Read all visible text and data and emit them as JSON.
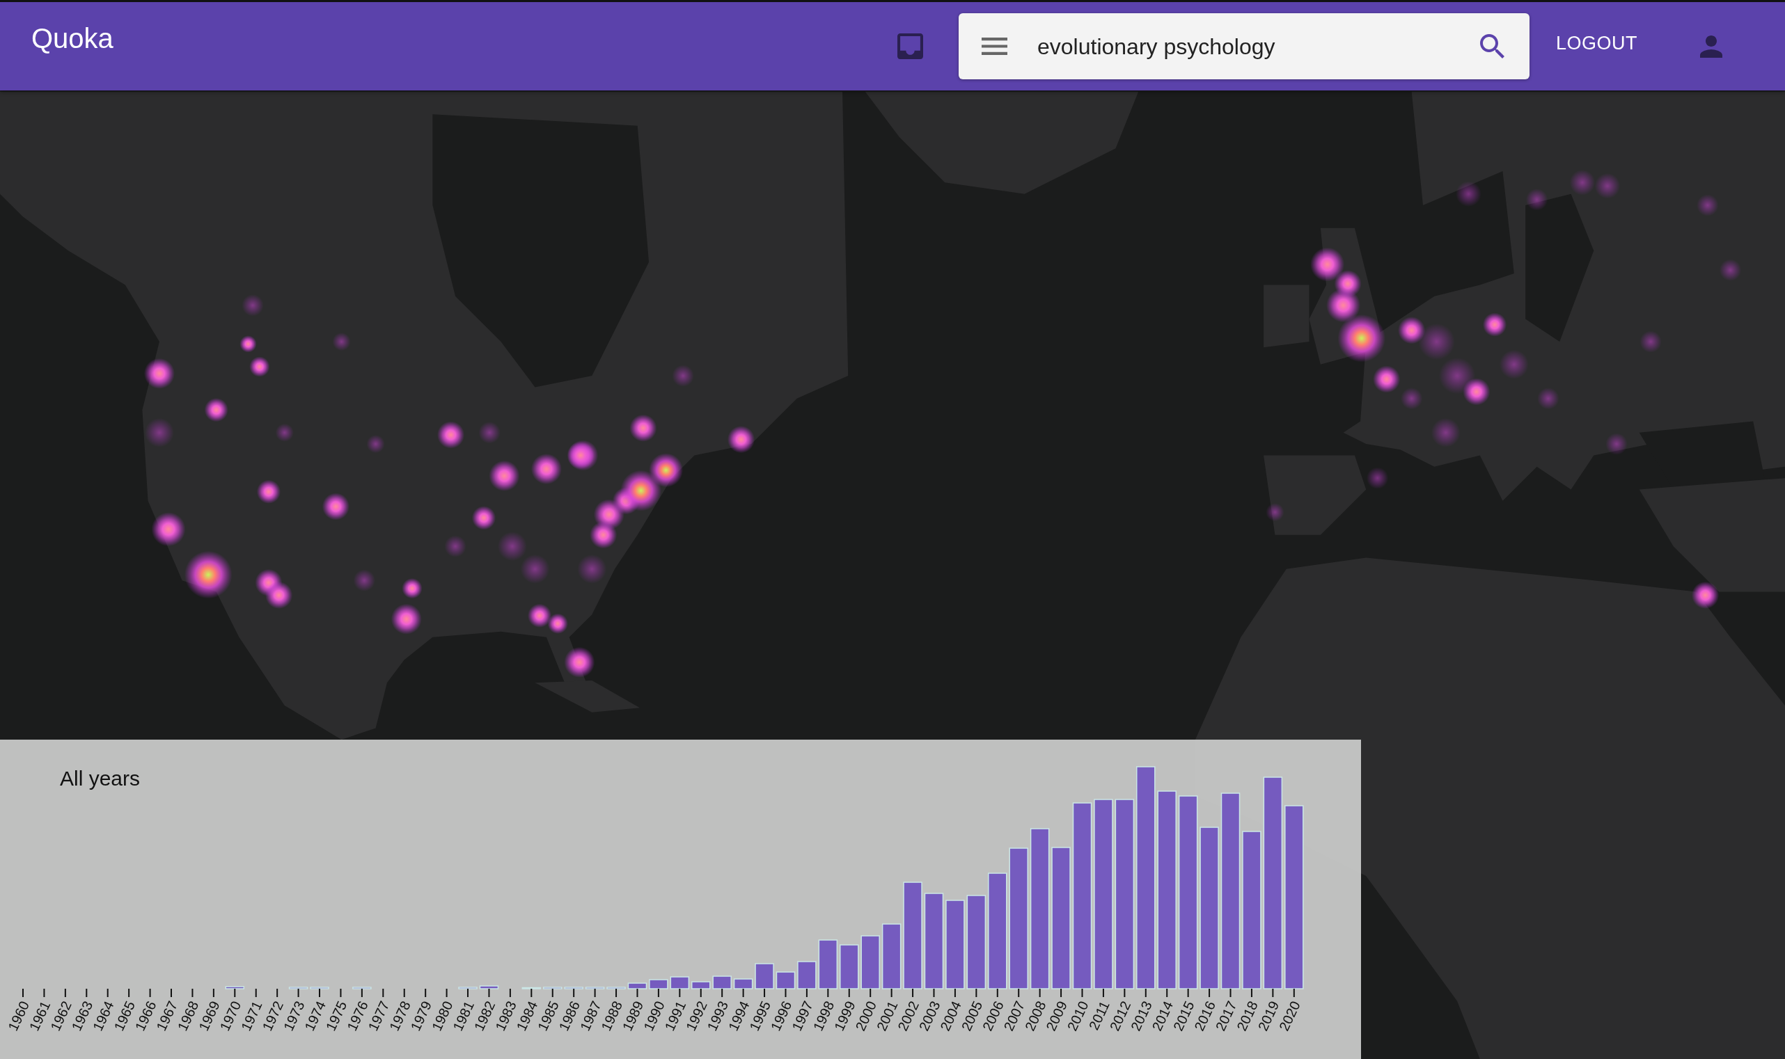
{
  "app_bar": {
    "title": "Quoka",
    "search": {
      "value": "evolutionary psychology"
    },
    "logout_button": "LOGOUT"
  },
  "histogram": {
    "title": "All years",
    "year_labels": [
      "1960",
      "1961",
      "1962",
      "1963",
      "1964",
      "1965",
      "1966",
      "1967",
      "1968",
      "1969",
      "1970",
      "1971",
      "1972",
      "1973",
      "1974",
      "1975",
      "1976",
      "1977",
      "1978",
      "1979",
      "1980",
      "1981",
      "1982",
      "1983",
      "1984",
      "1985",
      "1986",
      "1987",
      "1988",
      "1989",
      "1990",
      "1991",
      "1992",
      "1993",
      "1994",
      "1995",
      "1996",
      "1997",
      "1998",
      "1999",
      "2000",
      "2001",
      "2002",
      "2003",
      "2004",
      "2005",
      "2006",
      "2007",
      "2008",
      "2009",
      "2010",
      "2011",
      "2012",
      "2013",
      "2014",
      "2015",
      "2016",
      "2017",
      "2018",
      "2019",
      "2020"
    ]
  }
}
